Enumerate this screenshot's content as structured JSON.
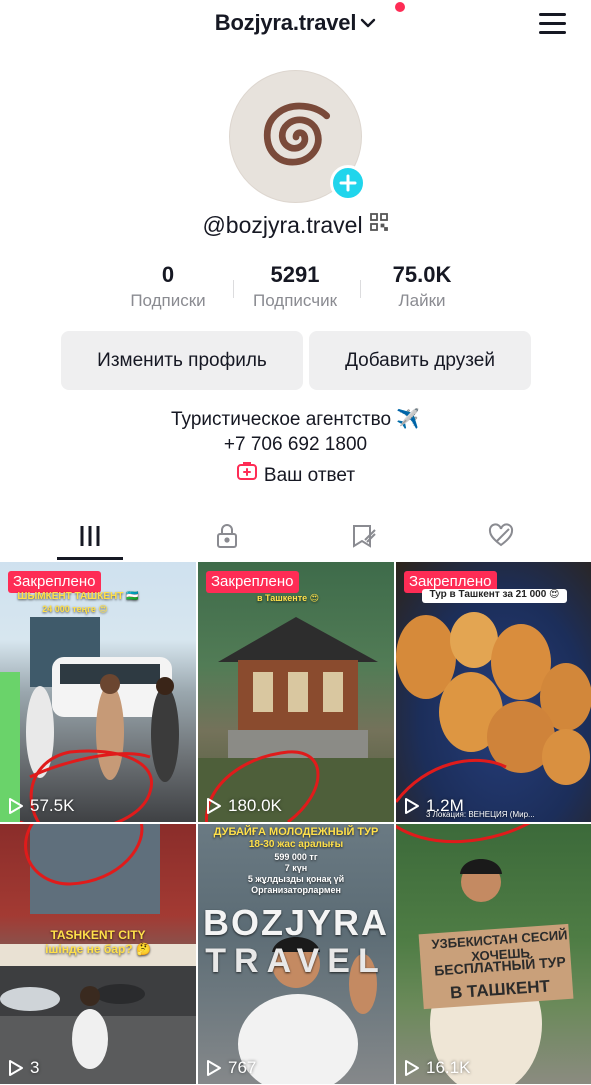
{
  "header": {
    "account_name": "Bozjyra.travel",
    "chevron_icon": "chevron-down-icon",
    "menu_icon": "hamburger-menu-icon",
    "notification_dot_color": "#fe2c55"
  },
  "profile": {
    "avatar_icon": "spiral-logo-icon",
    "add_icon": "plus-icon",
    "username": "@bozjyra.travel",
    "qr_icon": "qr-code-icon"
  },
  "stats": [
    {
      "value": "0",
      "label": "Подписки"
    },
    {
      "value": "5291",
      "label": "Подписчик"
    },
    {
      "value": "75.0K",
      "label": "Лайки"
    }
  ],
  "buttons": {
    "edit_profile": "Изменить профиль",
    "add_friends": "Добавить друзей"
  },
  "bio": {
    "line1": "Туристическое агентство ✈️",
    "line2": "+7 706 692 1800"
  },
  "answer": {
    "label": "Ваш ответ",
    "icon": "add-answer-icon"
  },
  "tabs": [
    {
      "name": "videos",
      "icon": "grid-bars-icon",
      "active": true
    },
    {
      "name": "private",
      "icon": "lock-icon"
    },
    {
      "name": "saved",
      "icon": "bookmark-icon"
    },
    {
      "name": "liked",
      "icon": "heart-hidden-icon"
    }
  ],
  "videos": [
    {
      "pinned": "Закреплено",
      "views": "57.5K",
      "caption": "ШЫМКЕНТ ТАШКЕНТ 🇺🇿",
      "caption2": "24 000 теңге 😍"
    },
    {
      "pinned": "Закреплено",
      "views": "180.0K",
      "caption": "в Ташкенте 😍"
    },
    {
      "pinned": "Закреплено",
      "views": "1.2M",
      "caption": "Тур в Ташкент за 21 000 😍",
      "caption2": "3 Локация: ВЕНЕЦИЯ (Мир..."
    },
    {
      "views": "3",
      "caption": "TASHKENT CITY",
      "caption2": "ішінде не бар? 🤔"
    },
    {
      "views": "767",
      "caption": "ДУБАЙҒА МОЛОДЕЖНЫЙ ТУР",
      "caption2": "18-30 жас аралығы",
      "caption3": "599 000 тг",
      "caption4": "7 күн",
      "caption5": "5 жұлдызды қонақ үй",
      "caption6": "Организаторлармен",
      "sign": "BOZJYRA",
      "sign2": "TRAVEL"
    },
    {
      "views": "16.1K",
      "sign": "УЗБЕКИСТАН СЕСИЙ ХОЧЕШЬ",
      "sign2": "БЕСПЛАТНЫЙ ТУР",
      "sign3": "В ТАШКЕНТ"
    }
  ],
  "colors": {
    "accent_red": "#fe2c55",
    "add_badge": "#20d5ec",
    "button_bg": "#efeff0"
  }
}
